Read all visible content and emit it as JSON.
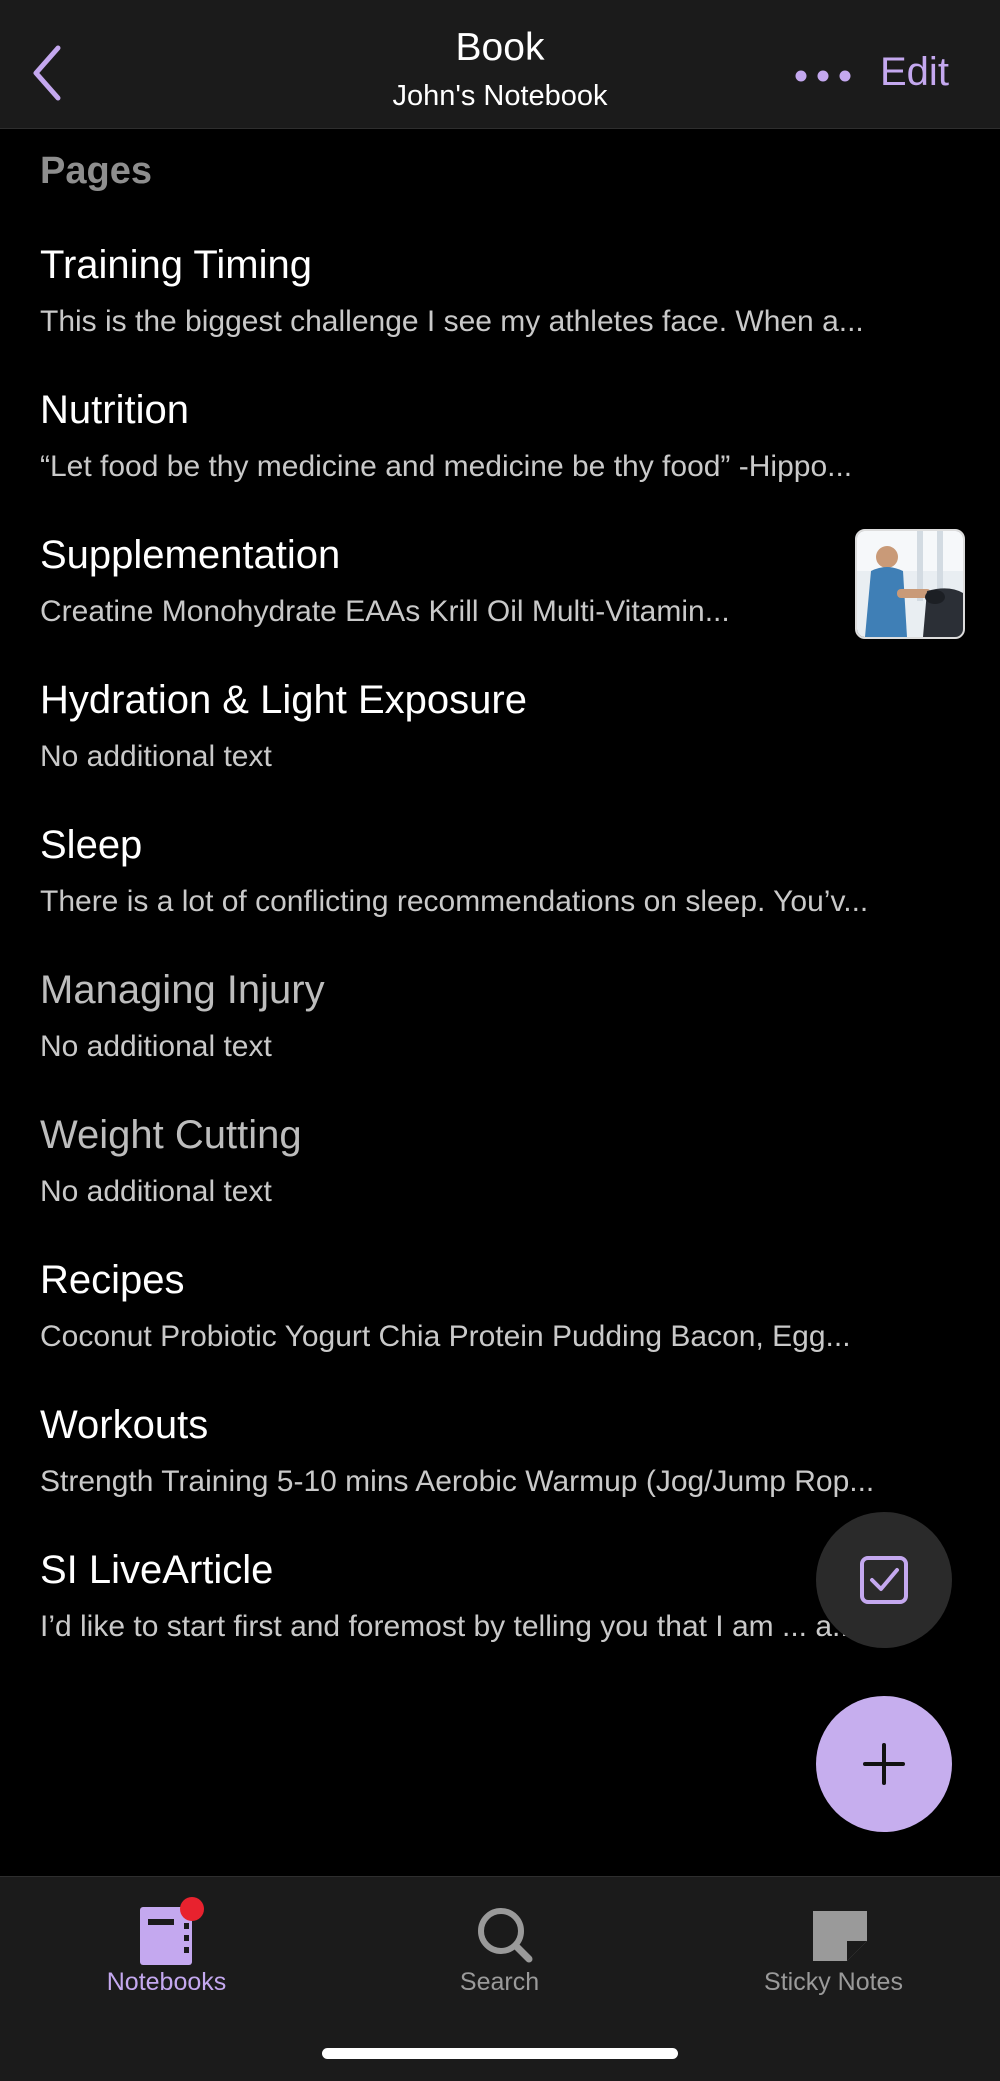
{
  "header": {
    "title": "Book",
    "subtitle": "John's Notebook",
    "edit_label": "Edit",
    "back_icon": "chevron-left-icon",
    "more_icon": "ellipsis-icon",
    "accent_color": "#c4a8ef"
  },
  "section": {
    "label": "Pages"
  },
  "pages": [
    {
      "title": "Training Timing",
      "preview": "This is the biggest challenge I see my athletes face. When a..."
    },
    {
      "title": "Nutrition",
      "preview": "“Let food be thy medicine and medicine be thy food”  -Hippo..."
    },
    {
      "title": "Supplementation",
      "preview": "Creatine Monohydrate  EAAs  Krill Oil  Multi-Vitamin...",
      "thumbnail": "doctor-blood-pressure-photo"
    },
    {
      "title": "Hydration & Light Exposure",
      "preview": "No additional text"
    },
    {
      "title": "Sleep",
      "preview": "There is a lot of conflicting recommendations on sleep. You’v..."
    },
    {
      "title": "Managing Injury",
      "preview": "No additional text"
    },
    {
      "title": "Weight Cutting",
      "preview": "No additional text"
    },
    {
      "title": "Recipes",
      "preview": "Coconut Probiotic Yogurt  Chia Protein Pudding  Bacon, Egg..."
    },
    {
      "title": "Workouts",
      "preview": "Strength Training  5-10 mins Aerobic Warmup (Jog/Jump Rop..."
    },
    {
      "title": "SI LiveArticle",
      "preview": "I’d like to start first and foremost by telling you that I am ... a..."
    }
  ],
  "fabs": {
    "check_icon": "checkbox-icon",
    "add_icon": "plus-icon",
    "add_color": "#c6aeee"
  },
  "tabs": [
    {
      "label": "Notebooks",
      "icon": "notebook-icon",
      "active": true,
      "badge_color": "#e8222e"
    },
    {
      "label": "Search",
      "icon": "search-icon",
      "active": false
    },
    {
      "label": "Sticky Notes",
      "icon": "sticky-note-icon",
      "active": false
    }
  ]
}
